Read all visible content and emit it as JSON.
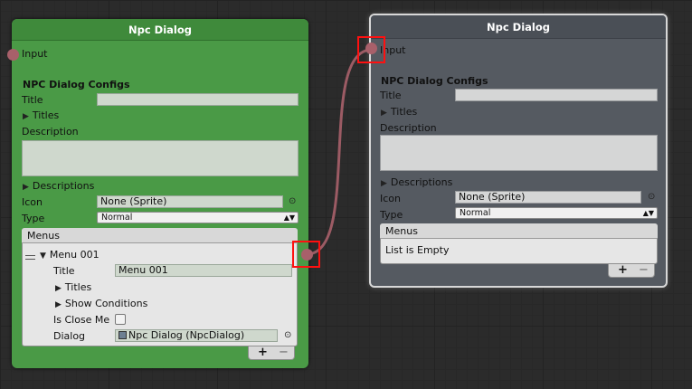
{
  "colors": {
    "green_node": "#4a9a46",
    "gray_node": "#555a61",
    "port": "#a8606a",
    "wire": "#b0646e",
    "highlight": "#ff1010"
  },
  "left_node": {
    "title": "Npc Dialog",
    "input_label": "Input",
    "section_title": "NPC Dialog Configs",
    "title_label": "Title",
    "title_value": "",
    "titles_foldout": "Titles",
    "description_label": "Description",
    "descriptions_foldout": "Descriptions",
    "icon_label": "Icon",
    "icon_value": "None (Sprite)",
    "type_label": "Type",
    "type_value": "Normal",
    "menus_header": "Menus",
    "menu_item": {
      "name": "Menu 001",
      "title_label": "Title",
      "title_value": "Menu 001",
      "titles_foldout": "Titles",
      "show_conditions_foldout": "Show Conditions",
      "is_close_label": "Is Close Me",
      "dialog_label": "Dialog",
      "dialog_value": "Npc Dialog (NpcDialog)"
    },
    "plus": "+",
    "minus": "−"
  },
  "right_node": {
    "title": "Npc Dialog",
    "input_label": "Input",
    "section_title": "NPC Dialog Configs",
    "title_label": "Title",
    "title_value": "",
    "titles_foldout": "Titles",
    "description_label": "Description",
    "descriptions_foldout": "Descriptions",
    "icon_label": "Icon",
    "icon_value": "None (Sprite)",
    "type_label": "Type",
    "type_value": "Normal",
    "menus_header": "Menus",
    "empty_text": "List is Empty",
    "plus": "+",
    "minus": "−"
  }
}
